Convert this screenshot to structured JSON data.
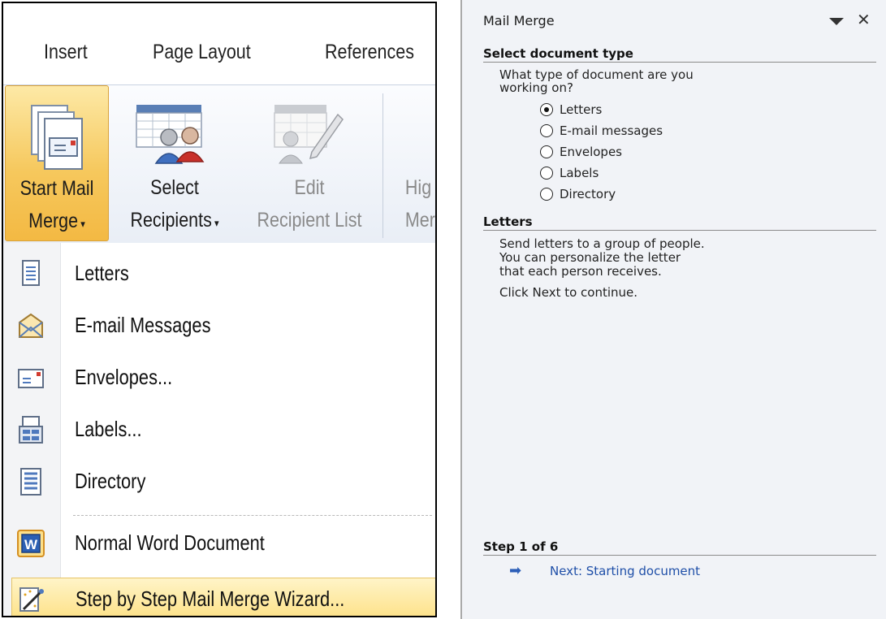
{
  "ribbon": {
    "tabs": [
      "Insert",
      "Page Layout",
      "References"
    ],
    "buttons": {
      "start_mail_merge": {
        "line1": "Start Mail",
        "line2": "Merge"
      },
      "select_recipients": {
        "line1": "Select",
        "line2": "Recipients"
      },
      "edit_recipient_list": {
        "line1": "Edit",
        "line2": "Recipient List"
      },
      "highlight_merge": {
        "line1": "Hig",
        "line2": "Merg"
      }
    }
  },
  "menu": {
    "items": [
      {
        "label": "Letters",
        "icon": "document-icon"
      },
      {
        "label": "E-mail Messages",
        "icon": "envelope-open-icon"
      },
      {
        "label": "Envelopes...",
        "icon": "envelope-icon"
      },
      {
        "label": "Labels...",
        "icon": "labels-icon"
      },
      {
        "label": "Directory",
        "icon": "directory-icon"
      },
      {
        "label": "Normal Word Document",
        "icon": "word-icon"
      },
      {
        "label": "Step by Step Mail Merge Wizard...",
        "icon": "wizard-icon"
      }
    ]
  },
  "pane": {
    "title": "Mail Merge",
    "section1": {
      "heading": "Select document type",
      "question_line1": "What type of document are you",
      "question_line2": "working on?",
      "options": [
        {
          "label": "Letters",
          "selected": true
        },
        {
          "label": "E-mail messages",
          "selected": false
        },
        {
          "label": "Envelopes",
          "selected": false
        },
        {
          "label": "Labels",
          "selected": false
        },
        {
          "label": "Directory",
          "selected": false
        }
      ]
    },
    "section2": {
      "heading": "Letters",
      "desc_line1": "Send letters to a group of people.",
      "desc_line2": "You can personalize the letter",
      "desc_line3": "that each person receives.",
      "instruction": "Click Next to continue."
    },
    "step": {
      "heading": "Step 1 of 6",
      "next_label": "Next: Starting document"
    }
  },
  "colors": {
    "start_button": "#f6c85d",
    "wizard_highlight": "#fde28a",
    "link": "#1f4fa8",
    "pane_bg": "#f1f3f7"
  }
}
